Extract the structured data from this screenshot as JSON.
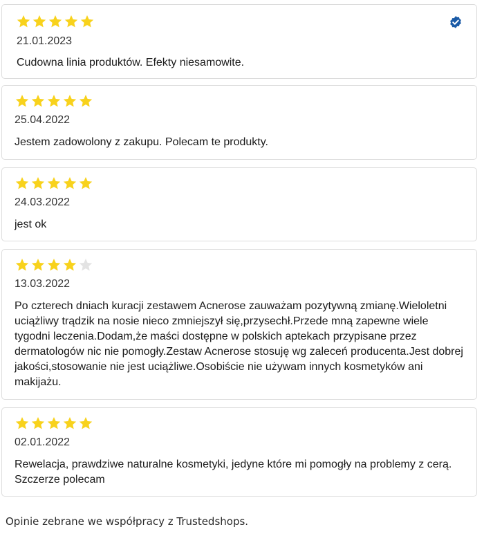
{
  "colors": {
    "star_filled": "#f8d21c",
    "star_empty": "#e3e3e3",
    "verified_badge": "#1a5aa6",
    "card_border": "#dcdcdc"
  },
  "reviews": [
    {
      "rating": 5,
      "date": "21.01.2023",
      "text": "Cudowna linia produktów. Efekty niesamowite.",
      "verified_icon": "verified-badge-icon"
    },
    {
      "rating": 5,
      "date": "25.04.2022",
      "text": "Jestem zadowolony z zakupu. Polecam te produkty."
    },
    {
      "rating": 5,
      "date": "24.03.2022",
      "text": "jest ok"
    },
    {
      "rating": 4,
      "date": "13.03.2022",
      "text": "Po czterech dniach kuracji zestawem Acnerose zauważam pozytywną zmianę.Wieloletni uciążliwy trądzik na nosie nieco zmniejszył się,przysechł.Przede mną zapewne wiele tygodni leczenia.Dodam,że maści dostępne w polskich aptekach przypisane przez dermatologów nic nie pomogły.Zestaw Acnerose stosuję wg zaleceń producenta.Jest dobrej jakości,stosowanie nie jest uciążliwe.Osobiście nie używam innych kosmetyków ani makijażu."
    },
    {
      "rating": 5,
      "date": "02.01.2022",
      "text": "Rewelacja, prawdziwe naturalne kosmetyki, jedyne które mi pomogły na problemy z cerą. Szczerze polecam"
    }
  ],
  "footer": {
    "text": "Opinie zebrane we współpracy z Trustedshops."
  }
}
